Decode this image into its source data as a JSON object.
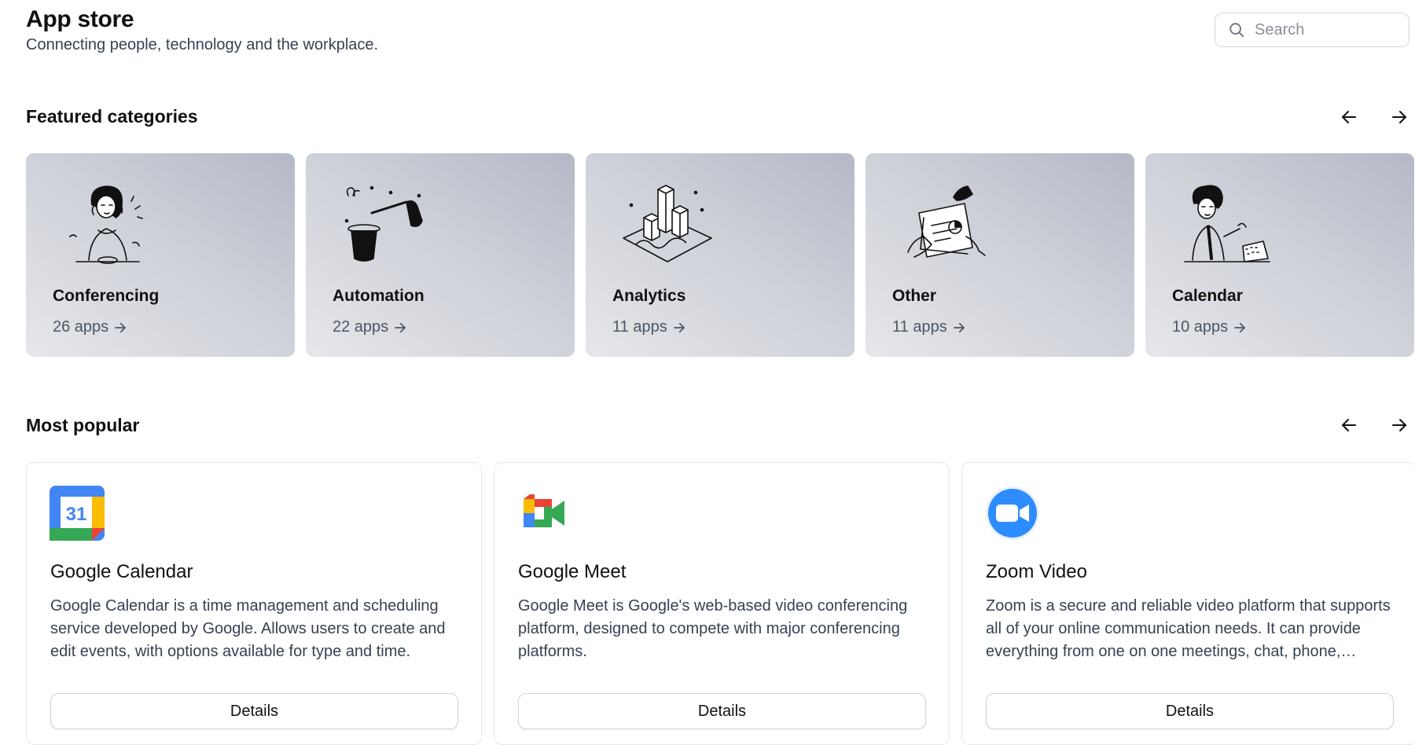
{
  "header": {
    "title": "App store",
    "subtitle": "Connecting people, technology and the workplace.",
    "search_placeholder": "Search",
    "search_icon": "search-icon"
  },
  "featured": {
    "title": "Featured categories",
    "prev_icon": "arrow-left-icon",
    "next_icon": "arrow-right-icon",
    "categories": [
      {
        "name": "Conferencing",
        "count": "26 apps",
        "illustration": "woman-on-phone-illustration"
      },
      {
        "name": "Automation",
        "count": "22 apps",
        "illustration": "magic-hat-illustration"
      },
      {
        "name": "Analytics",
        "count": "11 apps",
        "illustration": "bar-blocks-illustration"
      },
      {
        "name": "Other",
        "count": "11 apps",
        "illustration": "hands-document-illustration"
      },
      {
        "name": "Calendar",
        "count": "10 apps",
        "illustration": "person-calendar-illustration"
      }
    ]
  },
  "popular": {
    "title": "Most popular",
    "apps": [
      {
        "name": "Google Calendar",
        "description": "Google Calendar is a time management and scheduling service developed by Google. Allows users to create and edit events, with options available for type and time.",
        "button": "Details",
        "logo_text": "31",
        "icon": "google-calendar-icon"
      },
      {
        "name": "Google Meet",
        "description": "Google Meet is Google's web-based video conferencing platform, designed to compete with major conferencing platforms.",
        "button": "Details",
        "icon": "google-meet-icon"
      },
      {
        "name": "Zoom Video",
        "description": "Zoom is a secure and reliable video platform that supports all of your online communication needs. It can provide everything from one on one meetings, chat, phone, webinars, and large-scale online events.",
        "button": "Details",
        "icon": "zoom-icon"
      }
    ]
  },
  "colors": {
    "google_blue": "#4285F4",
    "google_red": "#EA4335",
    "google_yellow": "#FBBC04",
    "google_green": "#34A853",
    "zoom_blue": "#2D8CFF"
  }
}
